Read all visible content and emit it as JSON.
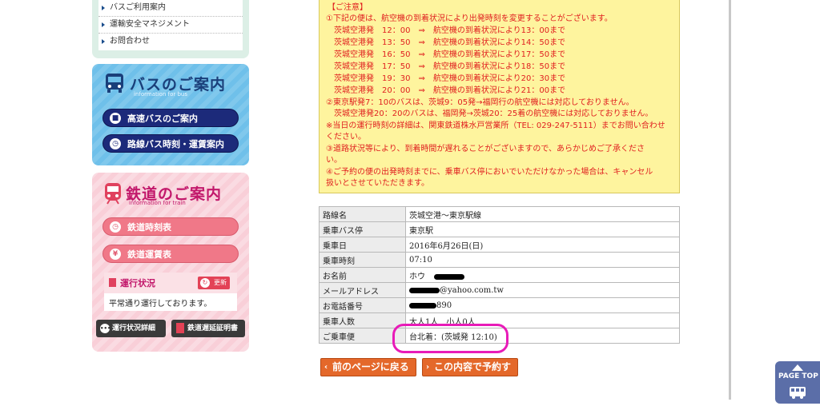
{
  "sidebar": {
    "links": [
      {
        "label": "バスご利用案内"
      },
      {
        "label": "運輸安全マネジメント"
      },
      {
        "label": "お問合わせ"
      }
    ],
    "bus_section": {
      "title": "バスのご案内",
      "subtitle": "information for bus",
      "buttons": [
        {
          "label": "高速バスのご案内",
          "icon": "bus-icon"
        },
        {
          "label": "路線バス時刻・運賃案内",
          "icon": "clock-icon"
        }
      ]
    },
    "train_section": {
      "title": "鉄道のご案内",
      "subtitle": "information for train",
      "buttons": [
        {
          "label": "鉄道時刻表",
          "icon": "clock-icon"
        },
        {
          "label": "鉄道運賃表",
          "icon": "yen-icon"
        }
      ],
      "status": {
        "title": "運行状況",
        "update_label": "更新",
        "text": "平常通り運行しております。"
      },
      "detail_button": "運行状況詳細",
      "certificate_button": "鉄道遅延証明書"
    }
  },
  "notice": {
    "heading": "【ご注意】",
    "lines": [
      "①下記の便は、航空機の到着状況により出発時刻を変更することがございます。",
      "　茨城空港発　12：00　⇒　航空機の到着状況により13：00まで",
      "　茨城空港発　13：50　⇒　航空機の到着状況により14：50まで",
      "　茨城空港発　16：50　⇒　航空機の到着状況により17：50まで",
      "　茨城空港発　17：50　⇒　航空機の到着状況により18：50まで",
      "　茨城空港発　19：30　⇒　航空機の到着状況により20：30まで",
      "　茨城空港発　20：00　⇒　航空機の到着状況により21：00まで",
      "②東京駅発7：10のバスは、茨城9：05発→福岡行の航空機には対応しておりません。",
      "　茨城空港発20：20のバスは、福岡発→茨城20：25着の航空機には対応しておりません。",
      "※当日の運行時刻の詳細は、関東鉄道株水戸営業所（TEL: 029-247-5111）までお問い合わせ",
      "ください。",
      "③道路状況等により、到着時間が遅れることがございますので、あらかじめご了承くださ",
      "い。",
      "④ご予約の便の出発時刻までに、乗車バス停においでいただけなかった場合は、キャンセル",
      "扱いとさせていただきます。"
    ]
  },
  "reservation": {
    "rows": [
      {
        "label": "路線名",
        "value": "茨城空港〜東京駅線"
      },
      {
        "label": "乗車バス停",
        "value": "東京駅"
      },
      {
        "label": "乗車日",
        "value": "2016年6月26日(日)"
      },
      {
        "label": "乗車時刻",
        "value": "07:10"
      },
      {
        "label": "お名前",
        "value": "ホウ"
      },
      {
        "label": "メールアドレス",
        "value": "@yahoo.com.tw"
      },
      {
        "label": "お電話番号",
        "value": "890"
      },
      {
        "label": "乗車人数",
        "value": "大人1人　小人0人"
      },
      {
        "label": "ご乗車便",
        "value": "台北着：(茨城発 12:10)"
      }
    ]
  },
  "actions": {
    "back": "前のページに戻る",
    "confirm": "この内容で予約する"
  },
  "page_top": {
    "label": "PAGE TOP"
  },
  "colors": {
    "bus_accent": "#1c2a7a",
    "train_accent": "#f07888",
    "notice_bg": "#fef49e",
    "notice_text": "#e02020",
    "action_orange": "#e4682a",
    "highlight": "#e81bb8"
  }
}
